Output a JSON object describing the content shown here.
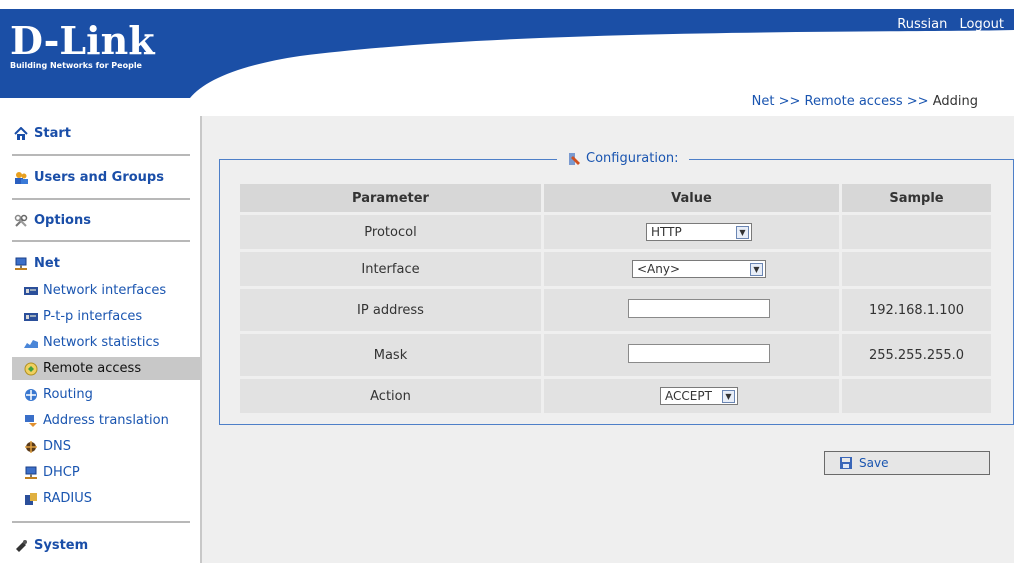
{
  "header": {
    "logo_text": "D-Link",
    "tagline": "Building Networks for People",
    "links": [
      "Russian",
      "Logout"
    ]
  },
  "breadcrumb": {
    "items": [
      "Net",
      "Remote access",
      "Adding"
    ],
    "separator": ">>"
  },
  "sidebar": {
    "sections": [
      {
        "label": "Start",
        "icon": "home-icon"
      },
      {
        "label": "Users and Groups",
        "icon": "users-icon"
      },
      {
        "label": "Options",
        "icon": "tools-icon"
      },
      {
        "label": "Net",
        "icon": "network-icon"
      },
      {
        "label": "System",
        "icon": "system-icon"
      }
    ],
    "net_items": [
      {
        "label": "Network interfaces",
        "icon": "network-card-icon"
      },
      {
        "label": "P-t-p interfaces",
        "icon": "network-card-icon"
      },
      {
        "label": "Network statistics",
        "icon": "statistics-icon"
      },
      {
        "label": "Remote access",
        "icon": "remote-access-icon",
        "active": true
      },
      {
        "label": "Routing",
        "icon": "routing-icon"
      },
      {
        "label": "Address translation",
        "icon": "translation-icon"
      },
      {
        "label": "DNS",
        "icon": "dns-icon"
      },
      {
        "label": "DHCP",
        "icon": "dhcp-icon"
      },
      {
        "label": "RADIUS",
        "icon": "radius-icon"
      }
    ]
  },
  "config": {
    "legend": "Configuration:",
    "headers": [
      "Parameter",
      "Value",
      "Sample"
    ],
    "rows": [
      {
        "param": "Protocol",
        "value": "HTTP",
        "control": "select",
        "sample": ""
      },
      {
        "param": "Interface",
        "value": "<Any>",
        "control": "select",
        "sample": ""
      },
      {
        "param": "IP address",
        "value": "",
        "control": "text",
        "sample": "192.168.1.100"
      },
      {
        "param": "Mask",
        "value": "",
        "control": "text",
        "sample": "255.255.255.0"
      },
      {
        "param": "Action",
        "value": "ACCEPT",
        "control": "select",
        "sample": ""
      }
    ]
  },
  "buttons": {
    "save": "Save"
  },
  "colors": {
    "brand_blue": "#1b4fa6",
    "link_blue": "#1a55b0",
    "panel_bg": "#efefef",
    "active_item_bg": "#c8c8c8"
  }
}
